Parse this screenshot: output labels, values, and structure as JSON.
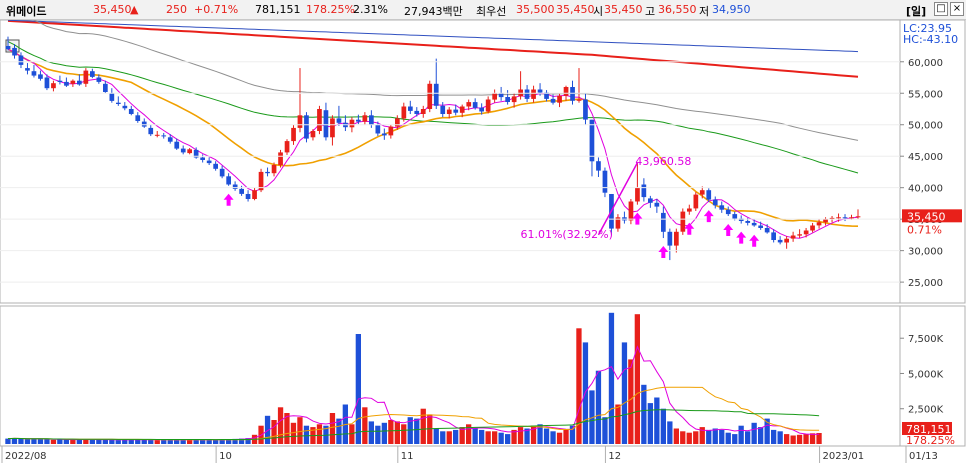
{
  "header": {
    "name": "위메이드",
    "price": "35,450",
    "change_arrow": "▲",
    "change": "250",
    "change_pct": "+0.71%",
    "volume": "781,151",
    "volume_ratio": "178.25%",
    "turnover": "2.31%",
    "amount": "27,943백만",
    "ask_label": "최우선",
    "ask": "35,500",
    "bid": "35,450",
    "open_label": "시",
    "open": "35,450",
    "high_label": "고",
    "high": "36,550",
    "low_label": "저",
    "low": "34,950",
    "window_label": "[일]",
    "restore_icon": "window-restore-icon",
    "close_icon": "window-close-icon",
    "up_color": "#e8201a",
    "down_color": "#1e50d8"
  },
  "chart_data": {
    "type": "candlestick",
    "price_axis": {
      "ylim": [
        22000,
        66000
      ],
      "ticks": [
        "60,000",
        "55,000",
        "50,000",
        "45,000",
        "40,000",
        "35,000",
        "30,000",
        "25,000"
      ],
      "tick_values": [
        60000,
        55000,
        50000,
        45000,
        40000,
        35000,
        30000,
        25000
      ]
    },
    "volume_axis": {
      "ylim": [
        0,
        9500
      ],
      "ticks": [
        "7,500K",
        "5,000K",
        "2,500K"
      ],
      "tick_values": [
        7500,
        5000,
        2500
      ]
    },
    "x_labels": [
      "2022/08",
      "10",
      "11",
      "12",
      "2023/01",
      "01/13"
    ],
    "x_label_index": [
      0,
      33,
      61,
      93,
      126,
      145
    ],
    "candles": [
      {
        "o": 62500,
        "h": 64000,
        "l": 61800,
        "c": 62000
      },
      {
        "o": 62200,
        "h": 62800,
        "l": 60500,
        "c": 61000
      },
      {
        "o": 61000,
        "h": 61500,
        "l": 59000,
        "c": 59500
      },
      {
        "o": 59000,
        "h": 59800,
        "l": 58000,
        "c": 58600
      },
      {
        "o": 58500,
        "h": 59500,
        "l": 57500,
        "c": 57800
      },
      {
        "o": 58000,
        "h": 58600,
        "l": 57000,
        "c": 57300
      },
      {
        "o": 57500,
        "h": 58000,
        "l": 55500,
        "c": 55800
      },
      {
        "o": 55800,
        "h": 57000,
        "l": 55300,
        "c": 56600
      },
      {
        "o": 57000,
        "h": 57800,
        "l": 56400,
        "c": 56800
      },
      {
        "o": 56800,
        "h": 57500,
        "l": 56000,
        "c": 56200
      },
      {
        "o": 56500,
        "h": 57200,
        "l": 56000,
        "c": 57000
      },
      {
        "o": 57000,
        "h": 58000,
        "l": 56200,
        "c": 56400
      },
      {
        "o": 56500,
        "h": 59000,
        "l": 56000,
        "c": 58600
      },
      {
        "o": 58500,
        "h": 58900,
        "l": 57400,
        "c": 57600
      },
      {
        "o": 57500,
        "h": 58000,
        "l": 56500,
        "c": 56800
      },
      {
        "o": 56500,
        "h": 57000,
        "l": 55000,
        "c": 55200
      },
      {
        "o": 55000,
        "h": 55800,
        "l": 53500,
        "c": 53800
      },
      {
        "o": 53500,
        "h": 54500,
        "l": 53000,
        "c": 53300
      },
      {
        "o": 53000,
        "h": 53600,
        "l": 52300,
        "c": 52600
      },
      {
        "o": 52500,
        "h": 53000,
        "l": 51500,
        "c": 51700
      },
      {
        "o": 51500,
        "h": 52000,
        "l": 50300,
        "c": 50600
      },
      {
        "o": 50500,
        "h": 51000,
        "l": 49500,
        "c": 49700
      },
      {
        "o": 49500,
        "h": 50000,
        "l": 48200,
        "c": 48500
      },
      {
        "o": 48300,
        "h": 49000,
        "l": 48000,
        "c": 48400
      },
      {
        "o": 48300,
        "h": 48700,
        "l": 47800,
        "c": 48200
      },
      {
        "o": 48000,
        "h": 48500,
        "l": 47000,
        "c": 47300
      },
      {
        "o": 47300,
        "h": 47800,
        "l": 46000,
        "c": 46200
      },
      {
        "o": 46200,
        "h": 46700,
        "l": 45300,
        "c": 45600
      },
      {
        "o": 45500,
        "h": 46300,
        "l": 45300,
        "c": 46100
      },
      {
        "o": 46000,
        "h": 46400,
        "l": 44600,
        "c": 44800
      },
      {
        "o": 44800,
        "h": 45300,
        "l": 44000,
        "c": 44400
      },
      {
        "o": 44300,
        "h": 44800,
        "l": 43600,
        "c": 43900
      },
      {
        "o": 43800,
        "h": 44200,
        "l": 42700,
        "c": 43000
      },
      {
        "o": 43000,
        "h": 43500,
        "l": 41500,
        "c": 41800
      },
      {
        "o": 41800,
        "h": 42300,
        "l": 40300,
        "c": 40500
      },
      {
        "o": 40500,
        "h": 41000,
        "l": 39500,
        "c": 39800
      },
      {
        "o": 39800,
        "h": 40300,
        "l": 38700,
        "c": 39000
      },
      {
        "o": 39000,
        "h": 39600,
        "l": 37800,
        "c": 38200
      },
      {
        "o": 38200,
        "h": 40000,
        "l": 38000,
        "c": 39600
      },
      {
        "o": 39600,
        "h": 43000,
        "l": 39300,
        "c": 42500
      },
      {
        "o": 42500,
        "h": 43200,
        "l": 41800,
        "c": 42300
      },
      {
        "o": 42300,
        "h": 44000,
        "l": 41800,
        "c": 43600
      },
      {
        "o": 43600,
        "h": 46000,
        "l": 43200,
        "c": 45600
      },
      {
        "o": 45600,
        "h": 47700,
        "l": 45200,
        "c": 47400
      },
      {
        "o": 47400,
        "h": 50000,
        "l": 46800,
        "c": 49500
      },
      {
        "o": 49500,
        "h": 59000,
        "l": 48800,
        "c": 51500
      },
      {
        "o": 51500,
        "h": 52000,
        "l": 47200,
        "c": 47800
      },
      {
        "o": 48000,
        "h": 49300,
        "l": 47500,
        "c": 49000
      },
      {
        "o": 49000,
        "h": 53000,
        "l": 48500,
        "c": 52500
      },
      {
        "o": 52300,
        "h": 53500,
        "l": 47500,
        "c": 48000
      },
      {
        "o": 48000,
        "h": 51500,
        "l": 46700,
        "c": 51000
      },
      {
        "o": 51000,
        "h": 53000,
        "l": 49800,
        "c": 50300
      },
      {
        "o": 50300,
        "h": 51500,
        "l": 49000,
        "c": 49600
      },
      {
        "o": 49600,
        "h": 51200,
        "l": 48800,
        "c": 50800
      },
      {
        "o": 50800,
        "h": 51600,
        "l": 50100,
        "c": 50500
      },
      {
        "o": 50500,
        "h": 52000,
        "l": 50000,
        "c": 51500
      },
      {
        "o": 51500,
        "h": 52300,
        "l": 49500,
        "c": 50000
      },
      {
        "o": 50000,
        "h": 50500,
        "l": 48200,
        "c": 48600
      },
      {
        "o": 48600,
        "h": 49400,
        "l": 47600,
        "c": 48300
      },
      {
        "o": 48300,
        "h": 50000,
        "l": 47800,
        "c": 49700
      },
      {
        "o": 49700,
        "h": 51500,
        "l": 49200,
        "c": 51000
      },
      {
        "o": 51000,
        "h": 53500,
        "l": 50500,
        "c": 52900
      },
      {
        "o": 52900,
        "h": 53800,
        "l": 51700,
        "c": 52200
      },
      {
        "o": 52200,
        "h": 52800,
        "l": 51300,
        "c": 51700
      },
      {
        "o": 51700,
        "h": 53000,
        "l": 51100,
        "c": 52500
      },
      {
        "o": 52500,
        "h": 57000,
        "l": 52000,
        "c": 56500
      },
      {
        "o": 56500,
        "h": 60500,
        "l": 52500,
        "c": 53000
      },
      {
        "o": 53000,
        "h": 53600,
        "l": 51200,
        "c": 51700
      },
      {
        "o": 51700,
        "h": 52800,
        "l": 51000,
        "c": 52400
      },
      {
        "o": 52400,
        "h": 53200,
        "l": 51500,
        "c": 51900
      },
      {
        "o": 51900,
        "h": 53200,
        "l": 51200,
        "c": 52900
      },
      {
        "o": 52900,
        "h": 54000,
        "l": 52300,
        "c": 53600
      },
      {
        "o": 53600,
        "h": 54200,
        "l": 52400,
        "c": 52700
      },
      {
        "o": 52700,
        "h": 53400,
        "l": 51600,
        "c": 52100
      },
      {
        "o": 52100,
        "h": 54500,
        "l": 51800,
        "c": 54000
      },
      {
        "o": 54000,
        "h": 55600,
        "l": 53500,
        "c": 55000
      },
      {
        "o": 55000,
        "h": 56000,
        "l": 53800,
        "c": 54400
      },
      {
        "o": 54400,
        "h": 55500,
        "l": 53200,
        "c": 53600
      },
      {
        "o": 53600,
        "h": 55000,
        "l": 52700,
        "c": 54500
      },
      {
        "o": 54500,
        "h": 58500,
        "l": 54000,
        "c": 55600
      },
      {
        "o": 55600,
        "h": 56300,
        "l": 53600,
        "c": 54100
      },
      {
        "o": 54100,
        "h": 56200,
        "l": 53500,
        "c": 55600
      },
      {
        "o": 55600,
        "h": 56600,
        "l": 54600,
        "c": 55100
      },
      {
        "o": 55100,
        "h": 55500,
        "l": 53700,
        "c": 54100
      },
      {
        "o": 54100,
        "h": 54800,
        "l": 53200,
        "c": 53500
      },
      {
        "o": 53500,
        "h": 55000,
        "l": 52800,
        "c": 54600
      },
      {
        "o": 54600,
        "h": 56200,
        "l": 53800,
        "c": 56000
      },
      {
        "o": 56000,
        "h": 57000,
        "l": 53200,
        "c": 53800
      },
      {
        "o": 53800,
        "h": 59000,
        "l": 53500,
        "c": 54000
      },
      {
        "o": 54000,
        "h": 55000,
        "l": 50000,
        "c": 50800
      },
      {
        "o": 50800,
        "h": 50000,
        "l": 41800,
        "c": 44200
      },
      {
        "o": 44200,
        "h": 44800,
        "l": 41700,
        "c": 42700
      },
      {
        "o": 42700,
        "h": 43200,
        "l": 38500,
        "c": 39200
      },
      {
        "o": 39000,
        "h": 38500,
        "l": 32500,
        "c": 33500
      },
      {
        "o": 33500,
        "h": 35800,
        "l": 33000,
        "c": 35300
      },
      {
        "o": 35300,
        "h": 36200,
        "l": 34300,
        "c": 34800
      },
      {
        "o": 34800,
        "h": 38200,
        "l": 34200,
        "c": 37800
      },
      {
        "o": 37800,
        "h": 43960,
        "l": 37300,
        "c": 40000
      },
      {
        "o": 40500,
        "h": 41500,
        "l": 37800,
        "c": 38500
      },
      {
        "o": 38300,
        "h": 38700,
        "l": 36800,
        "c": 37600
      },
      {
        "o": 37600,
        "h": 38200,
        "l": 36000,
        "c": 37000
      },
      {
        "o": 36000,
        "h": 37000,
        "l": 32000,
        "c": 33000
      },
      {
        "o": 33000,
        "h": 33500,
        "l": 28500,
        "c": 30800
      },
      {
        "o": 30800,
        "h": 33500,
        "l": 29700,
        "c": 33000
      },
      {
        "o": 33000,
        "h": 36700,
        "l": 32500,
        "c": 36200
      },
      {
        "o": 36200,
        "h": 37300,
        "l": 35700,
        "c": 36700
      },
      {
        "o": 36700,
        "h": 39300,
        "l": 36300,
        "c": 38900
      },
      {
        "o": 38900,
        "h": 40200,
        "l": 38300,
        "c": 39600
      },
      {
        "o": 39600,
        "h": 39900,
        "l": 37700,
        "c": 38100
      },
      {
        "o": 38100,
        "h": 38600,
        "l": 36700,
        "c": 37200
      },
      {
        "o": 37200,
        "h": 37800,
        "l": 36000,
        "c": 36500
      },
      {
        "o": 36500,
        "h": 37000,
        "l": 35500,
        "c": 35800
      },
      {
        "o": 35800,
        "h": 36200,
        "l": 34800,
        "c": 35100
      },
      {
        "o": 35100,
        "h": 35600,
        "l": 34300,
        "c": 34700
      },
      {
        "o": 34700,
        "h": 35200,
        "l": 34000,
        "c": 34400
      },
      {
        "o": 34400,
        "h": 35000,
        "l": 33800,
        "c": 34000
      },
      {
        "o": 34000,
        "h": 34600,
        "l": 33300,
        "c": 33600
      },
      {
        "o": 33600,
        "h": 34200,
        "l": 32700,
        "c": 32900
      },
      {
        "o": 32900,
        "h": 33400,
        "l": 31300,
        "c": 31700
      },
      {
        "o": 31700,
        "h": 32300,
        "l": 31000,
        "c": 31300
      },
      {
        "o": 31300,
        "h": 32300,
        "l": 30300,
        "c": 31900
      },
      {
        "o": 31900,
        "h": 33000,
        "l": 31400,
        "c": 32400
      },
      {
        "o": 32400,
        "h": 33400,
        "l": 32000,
        "c": 32600
      },
      {
        "o": 32600,
        "h": 33600,
        "l": 32100,
        "c": 33200
      },
      {
        "o": 33200,
        "h": 34400,
        "l": 32900,
        "c": 34000
      },
      {
        "o": 34000,
        "h": 35000,
        "l": 33500,
        "c": 34500
      },
      {
        "o": 34500,
        "h": 35300,
        "l": 34000,
        "c": 35000
      },
      {
        "o": 35000,
        "h": 35500,
        "l": 34500,
        "c": 35200
      },
      {
        "o": 35200,
        "h": 35900,
        "l": 34600,
        "c": 35300
      },
      {
        "o": 35300,
        "h": 35800,
        "l": 34700,
        "c": 35200
      },
      {
        "o": 35200,
        "h": 35700,
        "l": 34900,
        "c": 35300
      },
      {
        "o": 35450,
        "h": 36550,
        "l": 34950,
        "c": 35450
      }
    ],
    "volumes": [
      380,
      420,
      360,
      350,
      380,
      340,
      330,
      300,
      320,
      310,
      300,
      320,
      340,
      310,
      300,
      300,
      290,
      280,
      300,
      310,
      320,
      300,
      290,
      280,
      300,
      310,
      290,
      280,
      300,
      300,
      310,
      290,
      300,
      320,
      340,
      360,
      380,
      420,
      650,
      1300,
      2000,
      1700,
      2600,
      2200,
      1500,
      1900,
      1300,
      1200,
      1400,
      1300,
      2200,
      1800,
      2800,
      1400,
      7800,
      2600,
      1600,
      1300,
      1500,
      1700,
      1600,
      1400,
      1900,
      1800,
      2500,
      2100,
      1100,
      900,
      900,
      1000,
      1200,
      1400,
      1100,
      1000,
      900,
      900,
      800,
      700,
      1000,
      1200,
      1100,
      1300,
      1400,
      1100,
      900,
      800,
      1000,
      1300,
      8200,
      7200,
      3800,
      5200,
      1900,
      9300,
      2800,
      7200,
      6000,
      9200,
      4200,
      2900,
      3300,
      2500,
      1600,
      1100,
      900,
      800,
      900,
      1200,
      1000,
      1100,
      1000,
      800,
      700,
      1300,
      900,
      1500,
      1200,
      1800,
      1000,
      900,
      700,
      600,
      650,
      700,
      760,
      781
    ],
    "price_overlays": [
      "ma5",
      "ma20",
      "ma60",
      "ma120"
    ],
    "volume_overlays": [
      "vma5",
      "vma20",
      "vma60"
    ],
    "annotations": [
      {
        "text": "43,960.58",
        "color": "#e000e0"
      },
      {
        "text": "61.01%(32.92%)",
        "color": "#e000e0"
      },
      {
        "text": "LC:23.95",
        "color": "#1e50d8"
      },
      {
        "text": "HC:-43.10",
        "color": "#1e50d8"
      },
      {
        "text": "35,450",
        "color": "#ffffff"
      },
      {
        "text": "0.71%",
        "color": "#e8201a"
      },
      {
        "text": "781,151",
        "color": "#ffffff"
      },
      {
        "text": "178.25%",
        "color": "#e8201a"
      }
    ],
    "arrows_up_index": [
      34,
      97,
      101,
      105,
      108,
      111,
      113,
      115
    ],
    "colors": {
      "up": "#e8201a",
      "down": "#1e50d8",
      "ma5": "#e000e0",
      "ma20": "#f0a000",
      "ma60": "#1a9a1a",
      "ma120": "#909090",
      "ma_long_a": "#e8201a",
      "ma_long_b": "#3050c0",
      "badge": "#e8201a"
    }
  }
}
